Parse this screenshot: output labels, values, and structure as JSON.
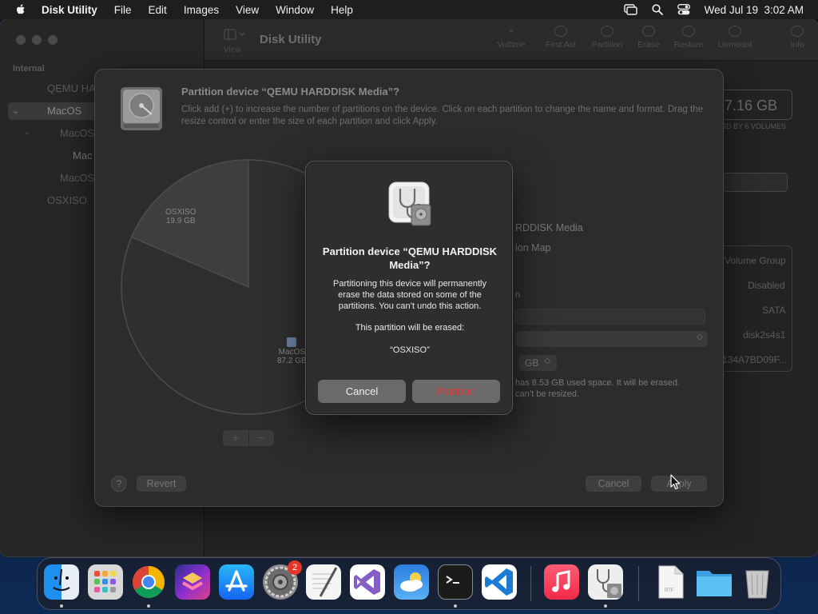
{
  "menubar": {
    "app": "Disk Utility",
    "items": [
      "File",
      "Edit",
      "Images",
      "View",
      "Window",
      "Help"
    ],
    "clock": "Wed Jul 19  3:02 AM"
  },
  "window": {
    "title": "Disk Utility",
    "toolbar": {
      "view_label": "View",
      "buttons": [
        "Volume",
        "First Aid",
        "Partition",
        "Erase",
        "Restore",
        "Unmount",
        "Info"
      ]
    },
    "sidebar": {
      "section": "Internal",
      "items": [
        "QEMU HA",
        "MacOS",
        "MacOS",
        "Mac",
        "MacOS",
        "OSXISO"
      ]
    },
    "main": {
      "capacity": "7.16 GB",
      "shared_by": "SD BY 6 VOLUMES",
      "info_values": [
        "Volume Group",
        "Disabled",
        "SATA",
        "disk2s4s1",
        "134A7BD09F..."
      ]
    }
  },
  "sheet": {
    "title": "Partition device “QEMU HARDDISK Media”?",
    "description": "Click add (+) to increase the number of partitions on the device. Click on each partition to change the name and format. Drag the resize control or enter the size of each partition and click Apply.",
    "pie": [
      {
        "name": "OSXISO",
        "size": "19.9 GB",
        "gb": 19.9
      },
      {
        "name": "MacOS",
        "size": "87.2 GB",
        "gb": 87.2
      }
    ],
    "right_panel": {
      "device_fragment": "RDDISK Media",
      "scheme_fragment": "ion Map",
      "size_unit": "GB",
      "note_line1": "has 8.53 GB used space. It will be erased.",
      "note_line2": "can’t be resized."
    },
    "buttons": {
      "help": "?",
      "revert": "Revert",
      "cancel": "Cancel",
      "apply": "Apply",
      "add": "+",
      "remove": "−"
    }
  },
  "alert": {
    "title": "Partition device “QEMU HARDDISK Media”?",
    "message": "Partitioning this device will permanently erase the data stored on some of the partitions. You can’t undo this action.",
    "erased_label": "This partition will be erased:",
    "erased_name": "“OSXISO”",
    "cancel_label": "Cancel",
    "partition_label": "Partition"
  },
  "dock": {
    "apps": [
      "Finder",
      "Launchpad",
      "Google Chrome",
      "Shortcuts",
      "App Store",
      "System Settings",
      "TextEdit",
      "Visual Studio",
      "Weather",
      "Terminal",
      "Visual Studio Code",
      "Music",
      "Disk Utility",
      "RTF Document",
      "Folder",
      "Trash"
    ],
    "settings_badge": "2",
    "rtf_label": "RTF"
  }
}
